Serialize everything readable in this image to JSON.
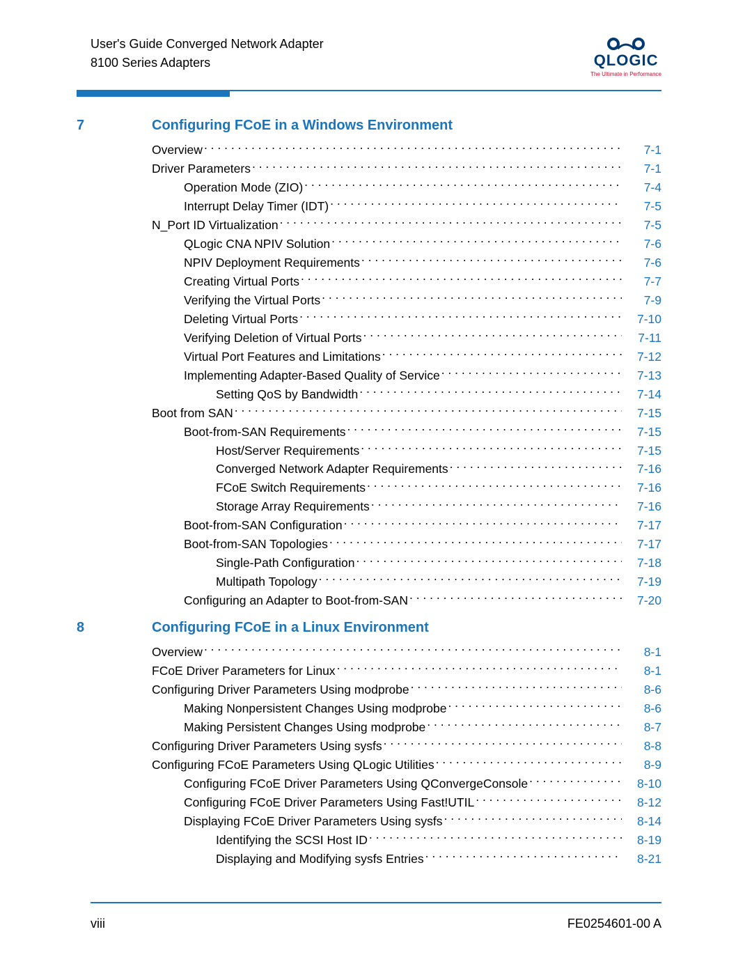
{
  "header": {
    "line1": "User's Guide Converged Network Adapter",
    "line2": "8100 Series Adapters"
  },
  "logo": {
    "name": "QLOGIC",
    "tagline": "The Ultimate in Performance"
  },
  "chapters": [
    {
      "num": "7",
      "title": "Configuring FCoE in a Windows Environment",
      "entries": [
        {
          "label": "Overview",
          "page": "7-1",
          "indent": 0
        },
        {
          "label": "Driver Parameters",
          "page": "7-1",
          "indent": 0
        },
        {
          "label": "Operation Mode (ZIO)",
          "page": "7-4",
          "indent": 1
        },
        {
          "label": "Interrupt Delay Timer (IDT)",
          "page": "7-5",
          "indent": 1
        },
        {
          "label": "N_Port ID Virtualization",
          "page": "7-5",
          "indent": 0
        },
        {
          "label": "QLogic CNA NPIV Solution",
          "page": "7-6",
          "indent": 1
        },
        {
          "label": "NPIV Deployment Requirements",
          "page": "7-6",
          "indent": 1
        },
        {
          "label": "Creating Virtual Ports",
          "page": "7-7",
          "indent": 1
        },
        {
          "label": "Verifying the Virtual Ports",
          "page": "7-9",
          "indent": 1
        },
        {
          "label": "Deleting Virtual Ports",
          "page": "7-10",
          "indent": 1
        },
        {
          "label": "Verifying Deletion of Virtual Ports",
          "page": "7-11",
          "indent": 1
        },
        {
          "label": "Virtual Port Features and Limitations",
          "page": "7-12",
          "indent": 1
        },
        {
          "label": "Implementing Adapter-Based Quality of Service",
          "page": "7-13",
          "indent": 1
        },
        {
          "label": "Setting QoS by Bandwidth",
          "page": "7-14",
          "indent": 2
        },
        {
          "label": "Boot from SAN",
          "page": "7-15",
          "indent": 0
        },
        {
          "label": "Boot-from-SAN Requirements",
          "page": "7-15",
          "indent": 1
        },
        {
          "label": "Host/Server Requirements",
          "page": "7-15",
          "indent": 2
        },
        {
          "label": "Converged Network Adapter Requirements",
          "page": "7-16",
          "indent": 2
        },
        {
          "label": "FCoE Switch Requirements",
          "page": "7-16",
          "indent": 2
        },
        {
          "label": "Storage Array Requirements",
          "page": "7-16",
          "indent": 2
        },
        {
          "label": "Boot-from-SAN Configuration",
          "page": "7-17",
          "indent": 1
        },
        {
          "label": "Boot-from-SAN Topologies",
          "page": "7-17",
          "indent": 1
        },
        {
          "label": "Single-Path Configuration",
          "page": "7-18",
          "indent": 2
        },
        {
          "label": "Multipath Topology",
          "page": "7-19",
          "indent": 2
        },
        {
          "label": "Configuring an Adapter to Boot-from-SAN",
          "page": "7-20",
          "indent": 1
        }
      ]
    },
    {
      "num": "8",
      "title": "Configuring FCoE in a Linux Environment",
      "entries": [
        {
          "label": "Overview",
          "page": "8-1",
          "indent": 0
        },
        {
          "label": "FCoE Driver Parameters for Linux",
          "page": "8-1",
          "indent": 0
        },
        {
          "label": "Configuring Driver Parameters Using modprobe",
          "page": "8-6",
          "indent": 0
        },
        {
          "label": "Making Nonpersistent Changes Using modprobe",
          "page": "8-6",
          "indent": 1
        },
        {
          "label": "Making Persistent Changes Using modprobe",
          "page": "8-7",
          "indent": 1
        },
        {
          "label": "Configuring Driver Parameters Using sysfs",
          "page": "8-8",
          "indent": 0
        },
        {
          "label": "Configuring FCoE Parameters Using QLogic Utilities",
          "page": "8-9",
          "indent": 0
        },
        {
          "label": "Configuring FCoE Driver Parameters Using QConvergeConsole",
          "page": "8-10",
          "indent": 1
        },
        {
          "label": "Configuring FCoE Driver Parameters Using Fast!UTIL",
          "page": "8-12",
          "indent": 1
        },
        {
          "label": "Displaying FCoE Driver Parameters Using sysfs",
          "page": "8-14",
          "indent": 1
        },
        {
          "label": "Identifying the SCSI Host ID",
          "page": "8-19",
          "indent": 2
        },
        {
          "label": "Displaying and Modifying sysfs Entries",
          "page": "8-21",
          "indent": 2
        }
      ]
    }
  ],
  "footer": {
    "left": "viii",
    "right": "FE0254601-00 A"
  }
}
